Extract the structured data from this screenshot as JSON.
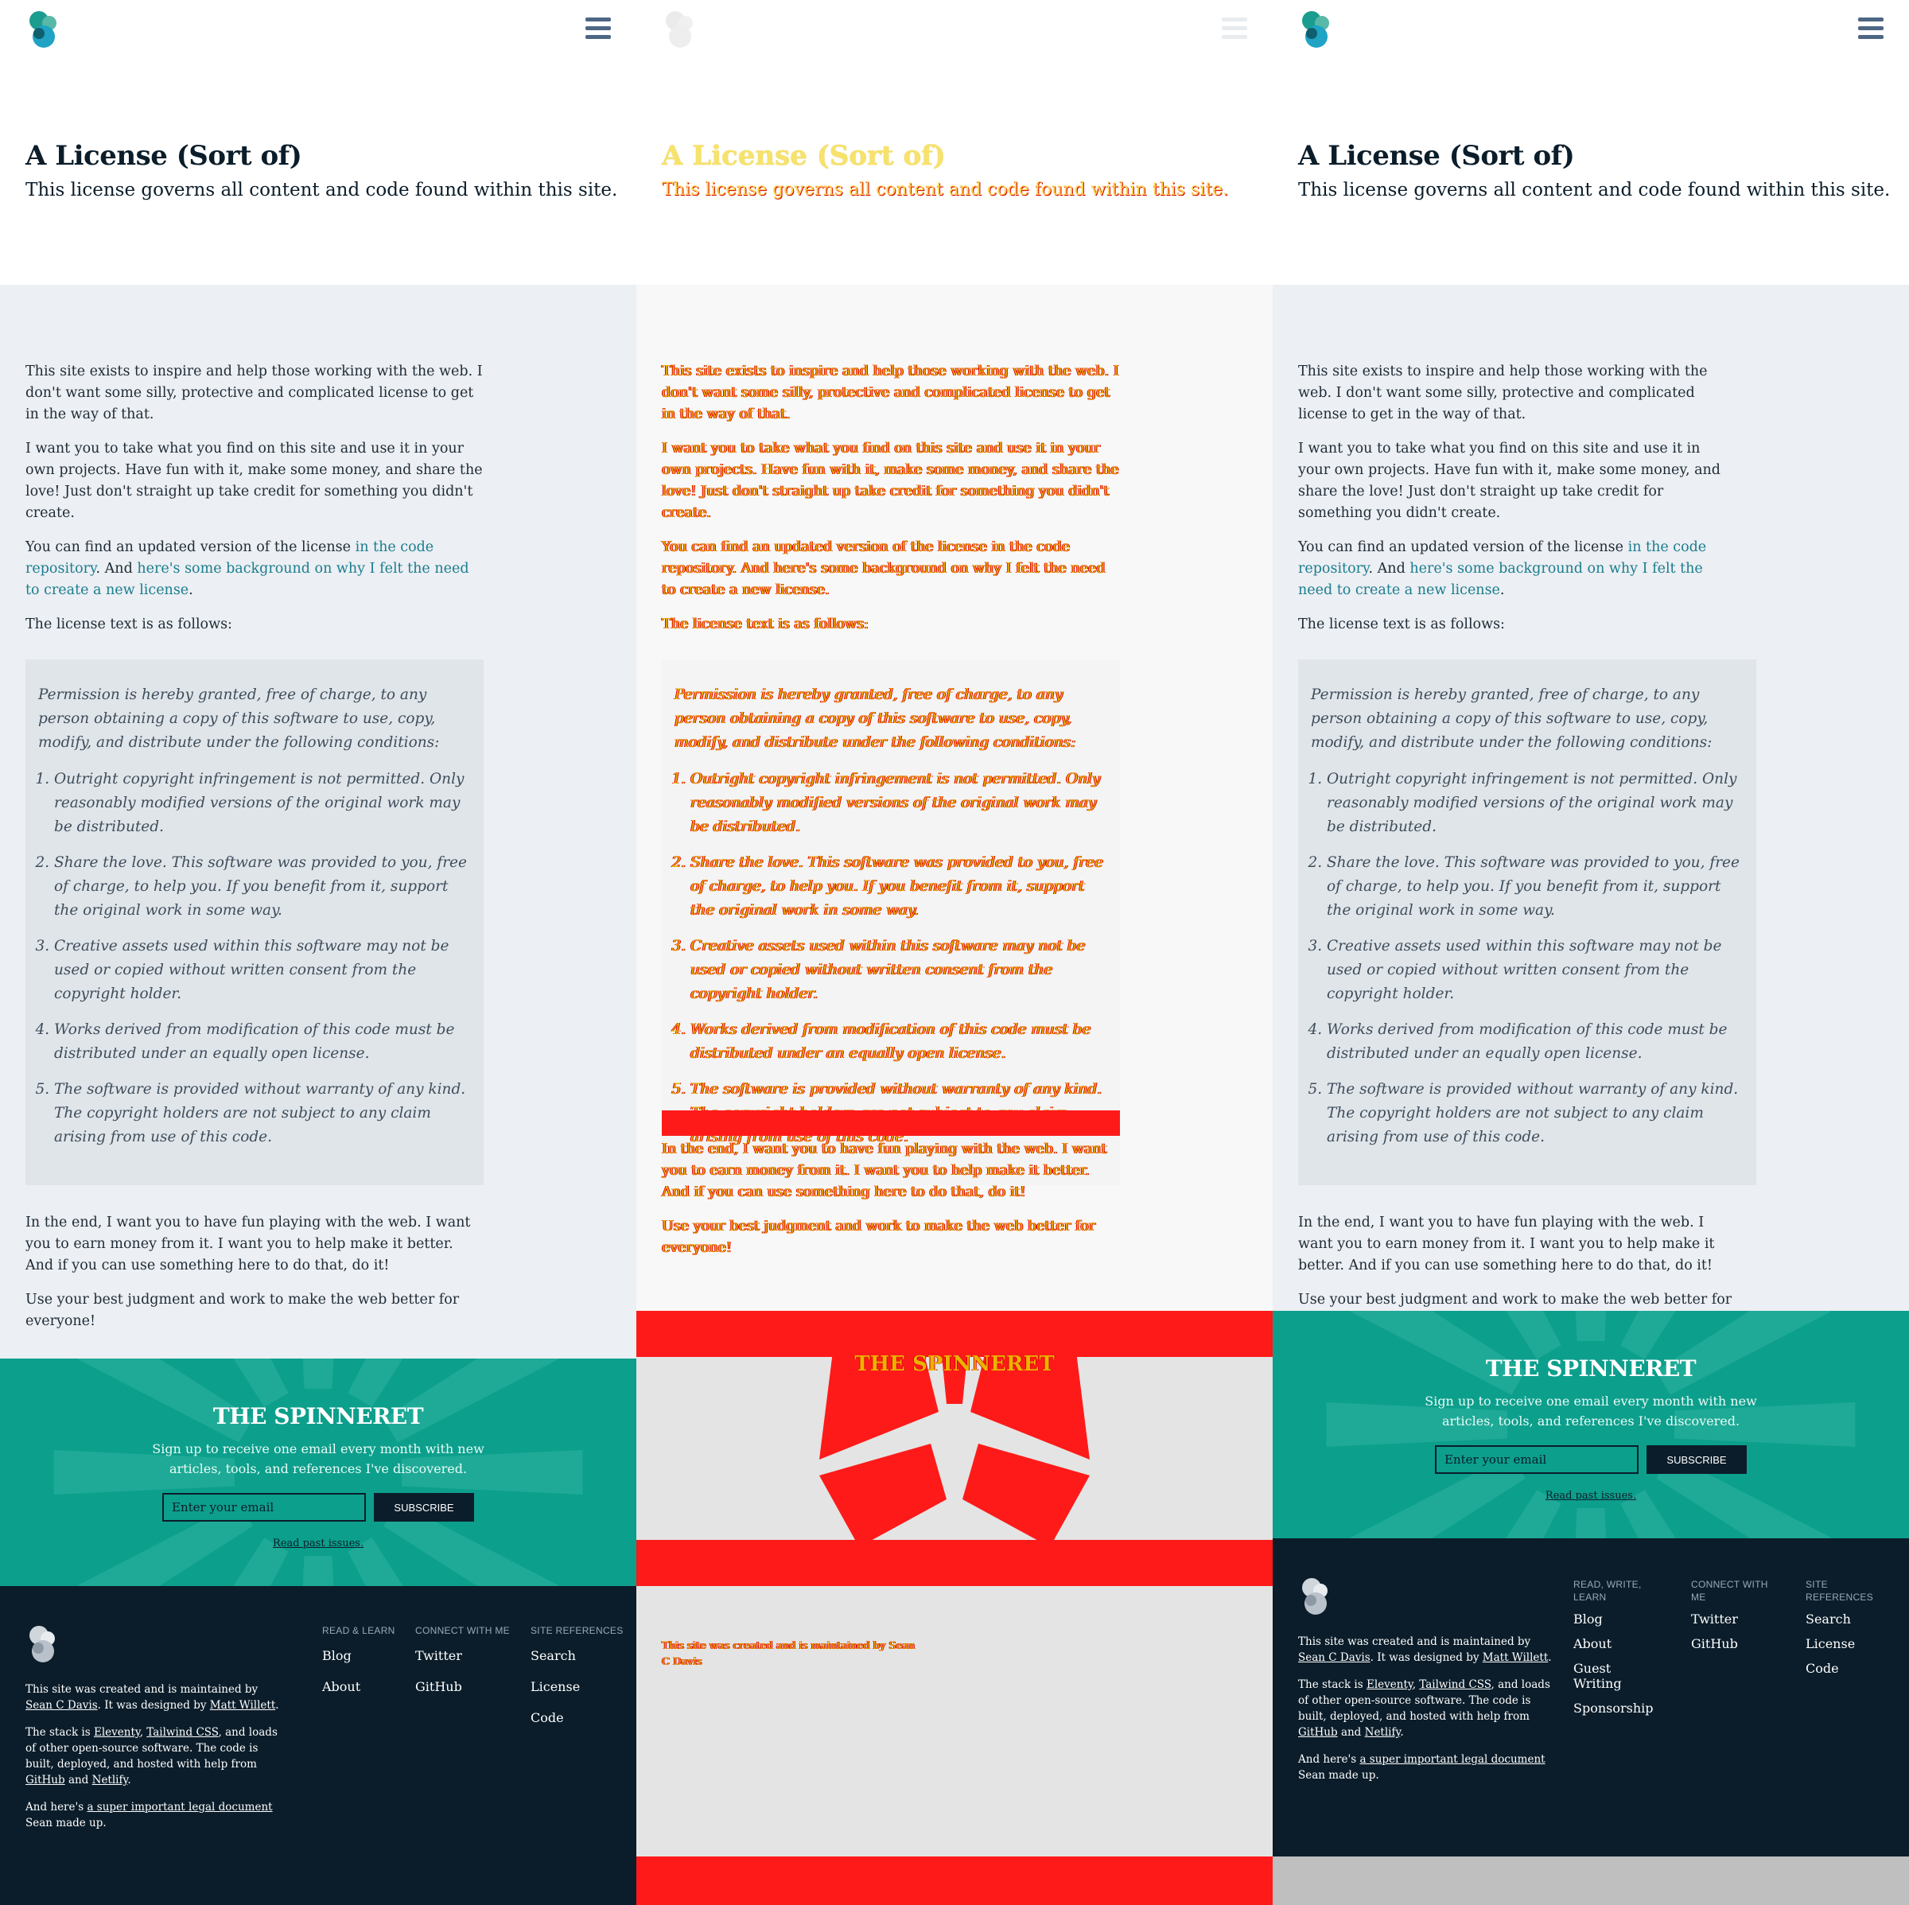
{
  "header": {
    "menu_label": "Menu"
  },
  "page": {
    "title": "A License (Sort of)",
    "subtitle": "This license governs all content and code found within this site."
  },
  "content": {
    "intro": "This site exists to inspire and help those working with the web. I don't want some silly, protective and complicated license to get in the way of that.",
    "para2": "I want you to take what you find on this site and use it in your own projects. Have fun with it, make some money, and share the love! Just don't straight up take credit for something you didn't create.",
    "para3_prefix": "You can find an updated version of the license",
    "repo_link": "in the code repository",
    "para3_mid": ". And",
    "background_link": "here's some background on why I felt the need to create a new license",
    "para3_suffix": ".",
    "text_intro": "The license text is as follows:",
    "license_lead": "Permission is hereby granted, free of charge, to any person obtaining a copy of this software to use, copy, modify, and distribute under the following conditions:",
    "license_items": [
      "Outright copyright infringement is not permitted. Only reasonably modified versions of the original work may be distributed.",
      "Share the love. This software was provided to you, free of charge, to help you. If you benefit from it, support the original work in some way.",
      "Creative assets used within this software may not be used or copied without written consent from the copyright holder.",
      "Works derived from modification of this code must be distributed under an equally open license.",
      "The software is provided without warranty of any kind. The copyright holders are not subject to any claim arising from use of this code."
    ],
    "closing1": "In the end, I want you to have fun playing with the web. I want you to earn money from it. I want you to help make it better. And if you can use something here to do that, do it!",
    "closing2": "Use your best judgment and work to make the web better for everyone!"
  },
  "newsletter": {
    "title": "THE SPINNERET",
    "text": "Sign up to receive one email every month with new articles, tools, and references I've discovered.",
    "placeholder": "Enter your email",
    "button": "SUBSCRIBE",
    "past_link": "Read past issues."
  },
  "footer": {
    "created_prefix": "This site was created and is maintained by",
    "author_link": "Sean C Davis",
    "designed_prefix": ". It was designed by",
    "designer_link": "Matt Willett",
    "designed_suffix": ".",
    "stack_prefix": "The stack is",
    "eleventy_link": "Eleventy",
    "comma": ",",
    "tailwind_link": "Tailwind CSS",
    "stack_mid": ", and loads of other open-source software. The code is built, deployed, and hosted with help from",
    "github_link": "GitHub",
    "and_word": "and",
    "netlify_link": "Netlify",
    "period": ".",
    "legal_prefix": "And here's",
    "legal_link": "a super important legal document",
    "legal_suffix": "Sean made up.",
    "columns_narrow": [
      {
        "heading": "READ & LEARN",
        "links": [
          "Blog",
          "About"
        ]
      },
      {
        "heading": "CONNECT WITH ME",
        "links": [
          "Twitter",
          "GitHub"
        ]
      },
      {
        "heading": "SITE REFERENCES",
        "links": [
          "Search",
          "License",
          "Code"
        ]
      }
    ],
    "columns_wide": [
      {
        "heading": "READ, WRITE, LEARN",
        "links": [
          "Blog",
          "About",
          "Guest Writing",
          "Sponsorship"
        ]
      },
      {
        "heading": "CONNECT WITH ME",
        "links": [
          "Twitter",
          "GitHub"
        ]
      },
      {
        "heading": "SITE REFERENCES",
        "links": [
          "Search",
          "License",
          "Code"
        ]
      }
    ]
  },
  "colors": {
    "brand_teal": "#0c9f8c",
    "navy": "#0b1d2a",
    "link": "#1a7d8f",
    "content_bg": "#eceff3",
    "diff_red": "#ff1a1a",
    "diff_yellow": "#e8b400"
  }
}
